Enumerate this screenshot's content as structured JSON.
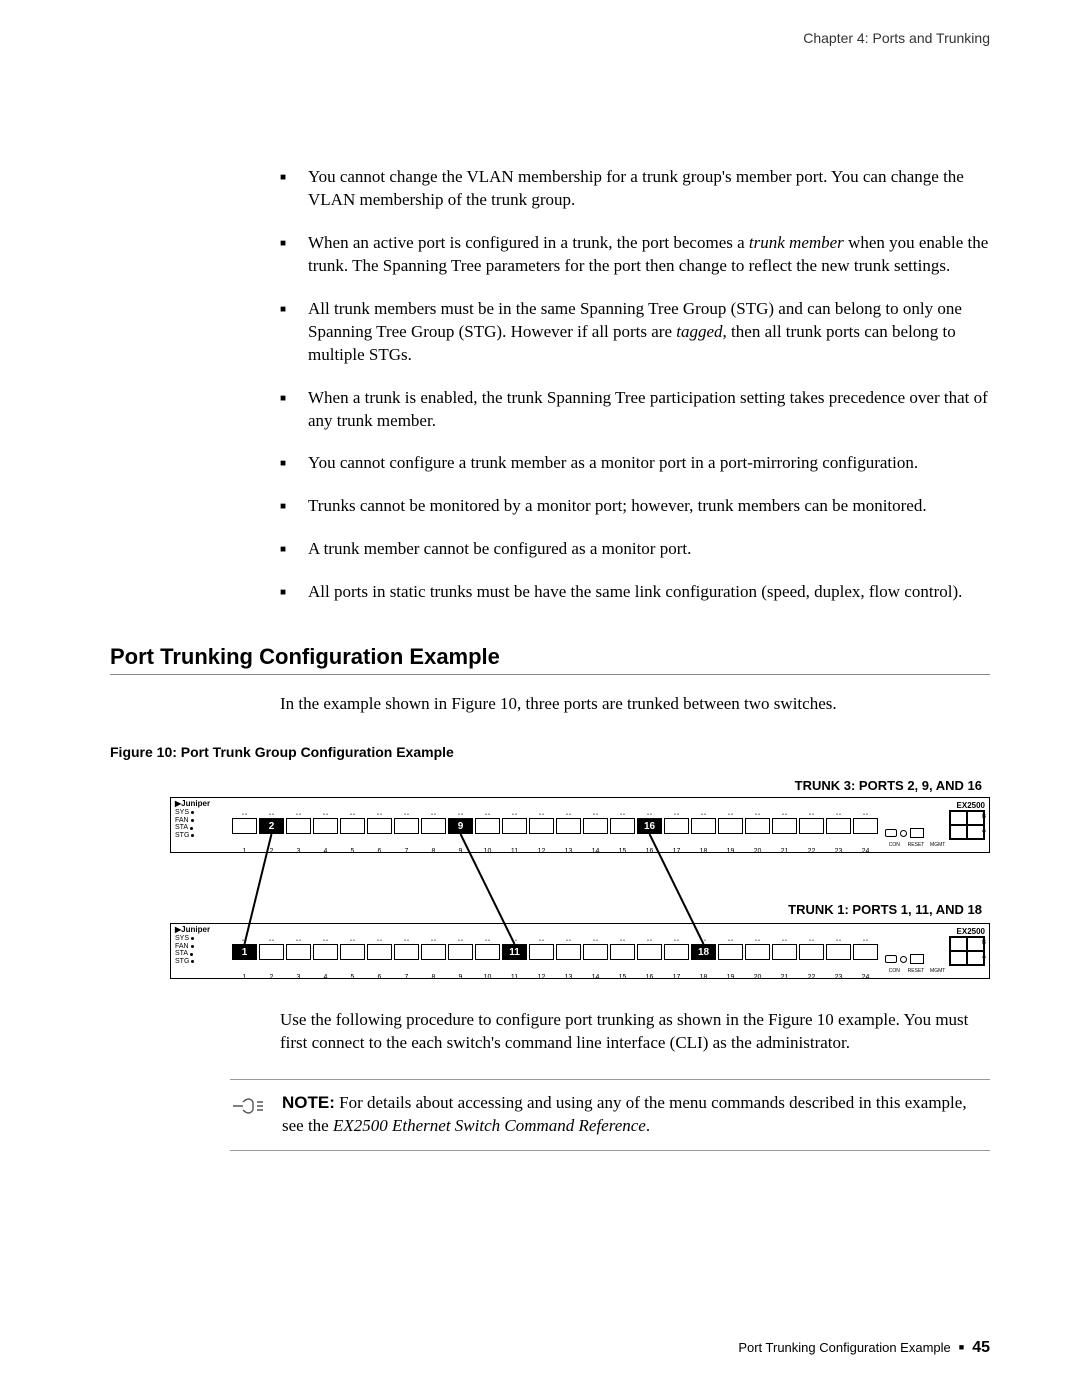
{
  "header": {
    "chapter": "Chapter 4: Ports and Trunking"
  },
  "bullets": [
    {
      "plain": "You cannot change the VLAN membership for a trunk group's member port. You can change the VLAN membership of the trunk group."
    },
    {
      "pre": "When an active port is configured in a trunk, the port becomes a ",
      "em": "trunk member",
      "post": " when you enable the trunk. The Spanning Tree parameters for the port then change to reflect the new trunk settings."
    },
    {
      "pre": "All trunk members must be in the same Spanning Tree Group (STG) and can belong to only one Spanning Tree Group (STG). However if all ports are ",
      "em": "tagged",
      "post": ", then all trunk ports can belong to multiple STGs."
    },
    {
      "plain": "When a trunk is enabled, the trunk Spanning Tree participation setting takes precedence over that of any trunk member."
    },
    {
      "plain": "You cannot configure a trunk member as a monitor port in a port-mirroring configuration."
    },
    {
      "plain": "Trunks cannot be monitored by a monitor port; however, trunk members can be monitored."
    },
    {
      "plain": "A trunk member cannot be configured as a monitor port."
    },
    {
      "plain": "All ports in static trunks must be have the same link configuration (speed, duplex, flow control)."
    }
  ],
  "section_heading": "Port Trunking Configuration Example",
  "intro": "In the example shown in Figure 10, three ports are trunked between two switches.",
  "figure_caption": "Figure 10:  Port Trunk Group Configuration Example",
  "figure": {
    "trunk3_label": "TRUNK 3: PORTS 2, 9, AND 16",
    "trunk1_label": "TRUNK 1: PORTS 1, 11, AND 18",
    "model": "EX2500",
    "brand": "Juniper",
    "leds": [
      "SYS",
      "FAN",
      "STA",
      "STG"
    ],
    "mgmt_labels": [
      "CON",
      "RESET",
      "MGMT"
    ],
    "port_numbers": [
      "1",
      "2",
      "3",
      "4",
      "5",
      "6",
      "7",
      "8",
      "9",
      "10",
      "11",
      "12",
      "13",
      "14",
      "15",
      "16",
      "17",
      "18",
      "19",
      "20",
      "21",
      "22",
      "23",
      "24"
    ],
    "top_hi": {
      "2": "2",
      "9": "9",
      "16": "16"
    },
    "bot_hi": {
      "1": "1",
      "11": "11",
      "18": "18"
    }
  },
  "after_figure": "Use the following procedure to configure port trunking as shown in the Figure 10 example. You must first connect to the each switch's command line interface (CLI) as the administrator.",
  "note": {
    "label": "NOTE:",
    "pre": " For details about accessing and using any of the menu commands described in this example, see the ",
    "em": "EX2500 Ethernet Switch Command Reference",
    "post": "."
  },
  "footer": {
    "section": "Port Trunking Configuration Example",
    "page": "45"
  }
}
